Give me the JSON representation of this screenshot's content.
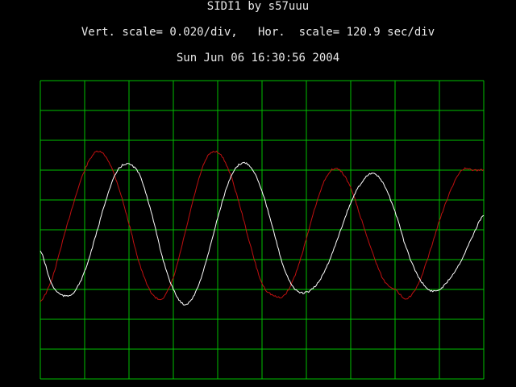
{
  "header": {
    "title": "SIDI1 by s57uuu",
    "scale_line": "Vert. scale= 0.020/div,   Hor.  scale= 120.9 sec/div",
    "timestamp": "Sun Jun 06 16:30:56 2004"
  },
  "colors": {
    "background": "#000000",
    "grid": "#00c000",
    "series_red": "#c01010",
    "series_white": "#ffffff"
  },
  "chart_data": {
    "type": "line",
    "title": "SIDI1 by s57uuu",
    "vertical_scale_per_div": 0.02,
    "horizontal_scale_sec_per_div": 120.9,
    "grid": true,
    "grid_divisions": {
      "x": 10,
      "y": 10
    },
    "xlim_div": [
      0,
      10
    ],
    "ylim_div": [
      -5,
      5
    ],
    "series": [
      {
        "color": "#c01010",
        "x_div": [
          0.0,
          0.25,
          0.5,
          0.75,
          1.0,
          1.25,
          1.5,
          1.75,
          2.0,
          2.25,
          2.5,
          2.75,
          3.0,
          3.25,
          3.5,
          3.75,
          4.0,
          4.25,
          4.5,
          4.75,
          5.0,
          5.25,
          5.5,
          5.75,
          6.0,
          6.25,
          6.5,
          6.75,
          7.0,
          7.25,
          7.5,
          7.75,
          8.0,
          8.25,
          8.5,
          8.75,
          9.0,
          9.25,
          9.5,
          9.75,
          10.0
        ],
        "y_div": [
          -2.4,
          -1.7,
          -0.4,
          0.9,
          2.0,
          2.6,
          2.4,
          1.5,
          0.2,
          -1.2,
          -2.1,
          -2.3,
          -1.6,
          -0.2,
          1.3,
          2.4,
          2.6,
          2.0,
          0.8,
          -0.6,
          -1.8,
          -2.2,
          -2.2,
          -1.5,
          -0.3,
          1.0,
          1.9,
          2.0,
          1.4,
          0.3,
          -0.8,
          -1.7,
          -2.0,
          -2.3,
          -1.9,
          -0.9,
          0.3,
          1.3,
          2.0,
          2.0,
          2.0
        ]
      },
      {
        "color": "#ffffff",
        "x_div": [
          0.0,
          0.25,
          0.5,
          0.75,
          1.0,
          1.25,
          1.5,
          1.75,
          2.0,
          2.25,
          2.5,
          2.75,
          3.0,
          3.25,
          3.5,
          3.75,
          4.0,
          4.25,
          4.5,
          4.75,
          5.0,
          5.25,
          5.5,
          5.75,
          6.0,
          6.25,
          6.5,
          6.75,
          7.0,
          7.25,
          7.5,
          7.75,
          8.0,
          8.25,
          8.5,
          8.75,
          9.0,
          9.25,
          9.5,
          9.75,
          10.0
        ],
        "y_div": [
          -0.7,
          -1.8,
          -2.2,
          -2.1,
          -1.4,
          -0.2,
          1.1,
          2.0,
          2.2,
          1.8,
          0.6,
          -0.9,
          -2.0,
          -2.5,
          -2.1,
          -1.0,
          0.4,
          1.6,
          2.2,
          2.1,
          1.3,
          0.0,
          -1.3,
          -2.0,
          -2.1,
          -1.8,
          -1.1,
          -0.1,
          0.9,
          1.6,
          1.9,
          1.5,
          0.6,
          -0.6,
          -1.5,
          -2.0,
          -2.0,
          -1.6,
          -1.0,
          -0.2,
          0.5
        ]
      }
    ]
  }
}
